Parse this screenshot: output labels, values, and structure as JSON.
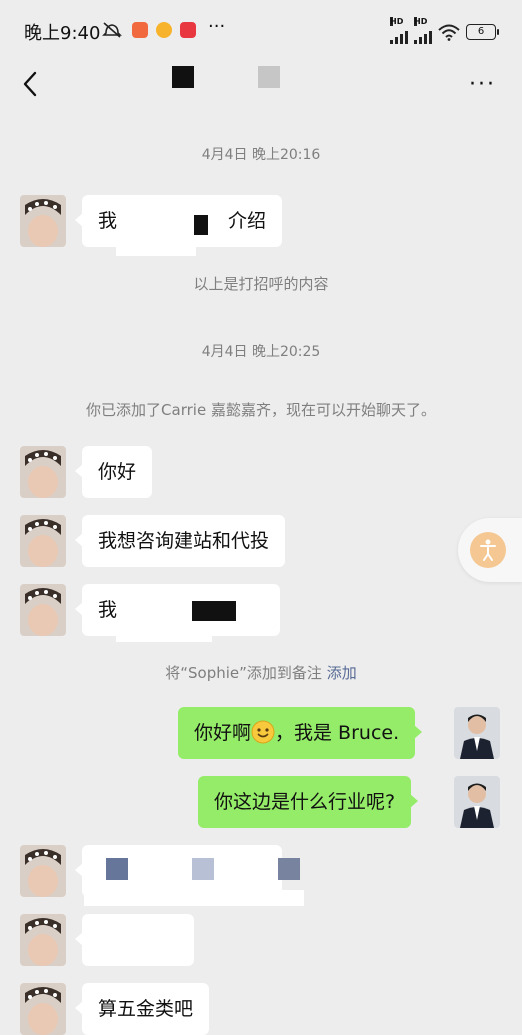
{
  "status_bar": {
    "time": "晚上9:40",
    "network_label": "HD",
    "battery": "6"
  },
  "nav": {
    "more_label": "···"
  },
  "colors": {
    "background": "#ededed",
    "incoming_bubble": "#ffffff",
    "outgoing_bubble": "#95ec69",
    "link": "#576b95",
    "timestamp_text": "#7f7f7f"
  },
  "chat": {
    "timestamp_1": "4月4日 晚上20:16",
    "first_message_start": "我",
    "first_message_end": "介绍",
    "greeting_notice": "以上是打招呼的内容",
    "timestamp_2": "4月4日 晚上20:25",
    "added_notice": "你已添加了Carrie 嘉懿嘉齐，现在可以开始聊天了。",
    "msg_hello": "你好",
    "msg_inquiry": "我想咨询建站和代投",
    "msg_partial": "我",
    "remark_notice": "将“Sophie”添加到备注",
    "remark_link": "添加",
    "reply_1_start": "你好啊",
    "reply_1_end": "，我是 Bruce.",
    "reply_2": "你这边是什么行业呢?",
    "msg_last": "算五金类吧"
  },
  "icons": [
    "back-arrow-icon",
    "more-icon",
    "smile-emoji-icon",
    "accessibility-icon",
    "mute-icon",
    "wifi-icon",
    "signal-icon",
    "battery-icon"
  ]
}
